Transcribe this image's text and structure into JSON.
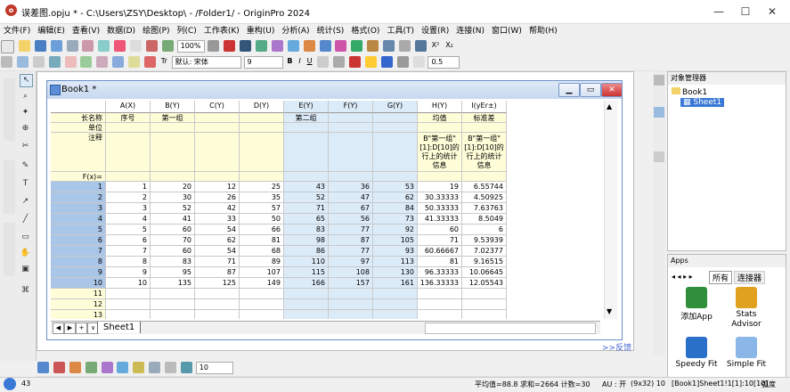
{
  "window": {
    "title": "误差图.opju * - C:\\Users\\ZSY\\Desktop\\ - /Folder1/ - OriginPro 2024",
    "app_icon": "origin-icon",
    "minimize": "—",
    "maximize": "☐",
    "close": "✕"
  },
  "menu": [
    "文件(F)",
    "编辑(E)",
    "查看(V)",
    "数据(D)",
    "绘图(P)",
    "列(C)",
    "工作表(K)",
    "重构(U)",
    "分析(A)",
    "统计(S)",
    "格式(O)",
    "工具(T)",
    "设置(R)",
    "连接(N)",
    "窗口(W)",
    "帮助(H)"
  ],
  "toolbar1": {
    "zoom": "100%"
  },
  "toolbar2": {
    "font_name": "默认: 宋体",
    "font_size": "9",
    "bold": "B",
    "italic": "I",
    "underline": "U",
    "line_width": "0.5"
  },
  "workbook": {
    "title": "Book1 *",
    "sheet_tab": "Sheet1",
    "columns": [
      {
        "name": "A(X)",
        "long_name": "序号",
        "units": "",
        "comment": ""
      },
      {
        "name": "B(Y)",
        "long_name": "第一组",
        "units": "",
        "comment": ""
      },
      {
        "name": "C(Y)",
        "long_name": "",
        "units": "",
        "comment": ""
      },
      {
        "name": "D(Y)",
        "long_name": "",
        "units": "",
        "comment": ""
      },
      {
        "name": "E(Y)",
        "long_name": "第二组",
        "units": "",
        "comment": ""
      },
      {
        "name": "F(Y)",
        "long_name": "",
        "units": "",
        "comment": ""
      },
      {
        "name": "G(Y)",
        "long_name": "",
        "units": "",
        "comment": ""
      },
      {
        "name": "H(Y)",
        "long_name": "均值",
        "units": "",
        "comment": "B\"第一组\"[1]:D[10]的行上的统计信息"
      },
      {
        "name": "I(yEr±)",
        "long_name": "标准差",
        "units": "",
        "comment": "B\"第一组\"[1]:D[10]的行上的统计信息"
      }
    ],
    "row_labels": [
      "长名称",
      "单位",
      "注释",
      "F(x)="
    ],
    "rows": [
      [
        "1",
        "20",
        "12",
        "25",
        "43",
        "36",
        "53",
        "19",
        "6.55744"
      ],
      [
        "2",
        "30",
        "26",
        "35",
        "52",
        "47",
        "62",
        "30.33333",
        "4.50925"
      ],
      [
        "3",
        "52",
        "42",
        "57",
        "71",
        "67",
        "84",
        "50.33333",
        "7.63763"
      ],
      [
        "4",
        "41",
        "33",
        "50",
        "65",
        "56",
        "73",
        "41.33333",
        "8.5049"
      ],
      [
        "5",
        "60",
        "54",
        "66",
        "83",
        "77",
        "92",
        "60",
        "6"
      ],
      [
        "6",
        "70",
        "62",
        "81",
        "98",
        "87",
        "105",
        "71",
        "9.53939"
      ],
      [
        "7",
        "60",
        "54",
        "68",
        "86",
        "77",
        "93",
        "60.66667",
        "7.02377"
      ],
      [
        "8",
        "83",
        "71",
        "89",
        "110",
        "97",
        "113",
        "81",
        "9.16515"
      ],
      [
        "9",
        "95",
        "87",
        "107",
        "115",
        "108",
        "130",
        "96.33333",
        "10.06645"
      ],
      [
        "10",
        "135",
        "125",
        "149",
        "166",
        "157",
        "161",
        "136.33333",
        "12.05543"
      ],
      [
        "",
        "",
        "",
        "",
        "",
        "",
        "",
        "",
        ""
      ],
      [
        "",
        "",
        "",
        "",
        "",
        "",
        "",
        "",
        ""
      ],
      [
        "",
        "",
        "",
        "",
        "",
        "",
        "",
        "",
        ""
      ]
    ],
    "view_back_link": ">>反馈"
  },
  "object_manager": {
    "title": "对象管理器",
    "book": "Book1",
    "sheet": "Sheet1"
  },
  "apps": {
    "title": "Apps",
    "tabs": [
      "所有",
      "连接器"
    ],
    "items": [
      {
        "label": "添加App",
        "color": "#2f8f3a"
      },
      {
        "label": "Stats\nAdvisor",
        "color": "#e0a020"
      },
      {
        "label": "Speedy Fit",
        "color": "#2a6fc8"
      },
      {
        "label": "Simple Fit",
        "color": "#8ab6e8"
      }
    ]
  },
  "status": {
    "left": "43",
    "stats": "平均值=88.8 求和=2664 计数=30",
    "au": "AU : 开",
    "dims": "(9x32) 10",
    "sheet": "[Book1]Sheet1!1[1]:10[10]",
    "angle": "弧度"
  }
}
